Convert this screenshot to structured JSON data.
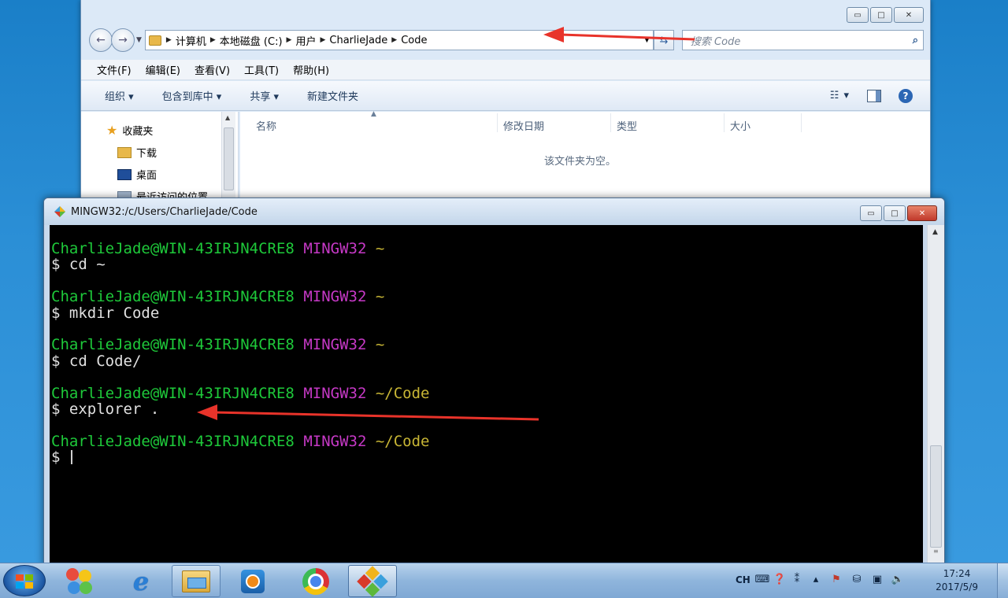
{
  "explorer": {
    "breadcrumb": [
      "计算机",
      "本地磁盘 (C:)",
      "用户",
      "CharlieJade",
      "Code"
    ],
    "search_placeholder": "搜索 Code",
    "menu": [
      "文件(F)",
      "编辑(E)",
      "查看(V)",
      "工具(T)",
      "帮助(H)"
    ],
    "commands": [
      "组织 ▾",
      "包含到库中 ▾",
      "共享 ▾",
      "新建文件夹"
    ],
    "nav": [
      {
        "label": "收藏夹",
        "icon": "star-icon"
      },
      {
        "label": "下载",
        "icon": "downloads-folder-icon"
      },
      {
        "label": "桌面",
        "icon": "desktop-icon"
      },
      {
        "label": "最近访问的位置",
        "icon": "recent-places-icon"
      }
    ],
    "columns": [
      "名称",
      "修改日期",
      "类型",
      "大小"
    ],
    "empty_message": "该文件夹为空。"
  },
  "terminal": {
    "title": "MINGW32:/c/Users/CharlieJade/Code",
    "user_host": "CharlieJade@WIN-43IRJN4CRE8",
    "system": "MINGW32",
    "blocks": [
      {
        "path": "~",
        "command": "$ cd ~"
      },
      {
        "path": "~",
        "command": "$ mkdir Code"
      },
      {
        "path": "~",
        "command": "$ cd Code/"
      },
      {
        "path": "~/Code",
        "command": "$ explorer ."
      },
      {
        "path": "~/Code",
        "command": "$ "
      }
    ]
  },
  "taskbar": {
    "apps": [
      "start-button",
      "qq-icon",
      "internet-explorer-icon",
      "windows-explorer-icon",
      "media-player-icon",
      "chrome-icon",
      "git-bash-icon"
    ],
    "ime": "CH",
    "time": "17:24",
    "date": "2017/5/9"
  },
  "colors": {
    "annotation_arrow": "#e8332a",
    "term_user": "#1ec93a",
    "term_system": "#c639c6",
    "term_path": "#c8b635"
  }
}
